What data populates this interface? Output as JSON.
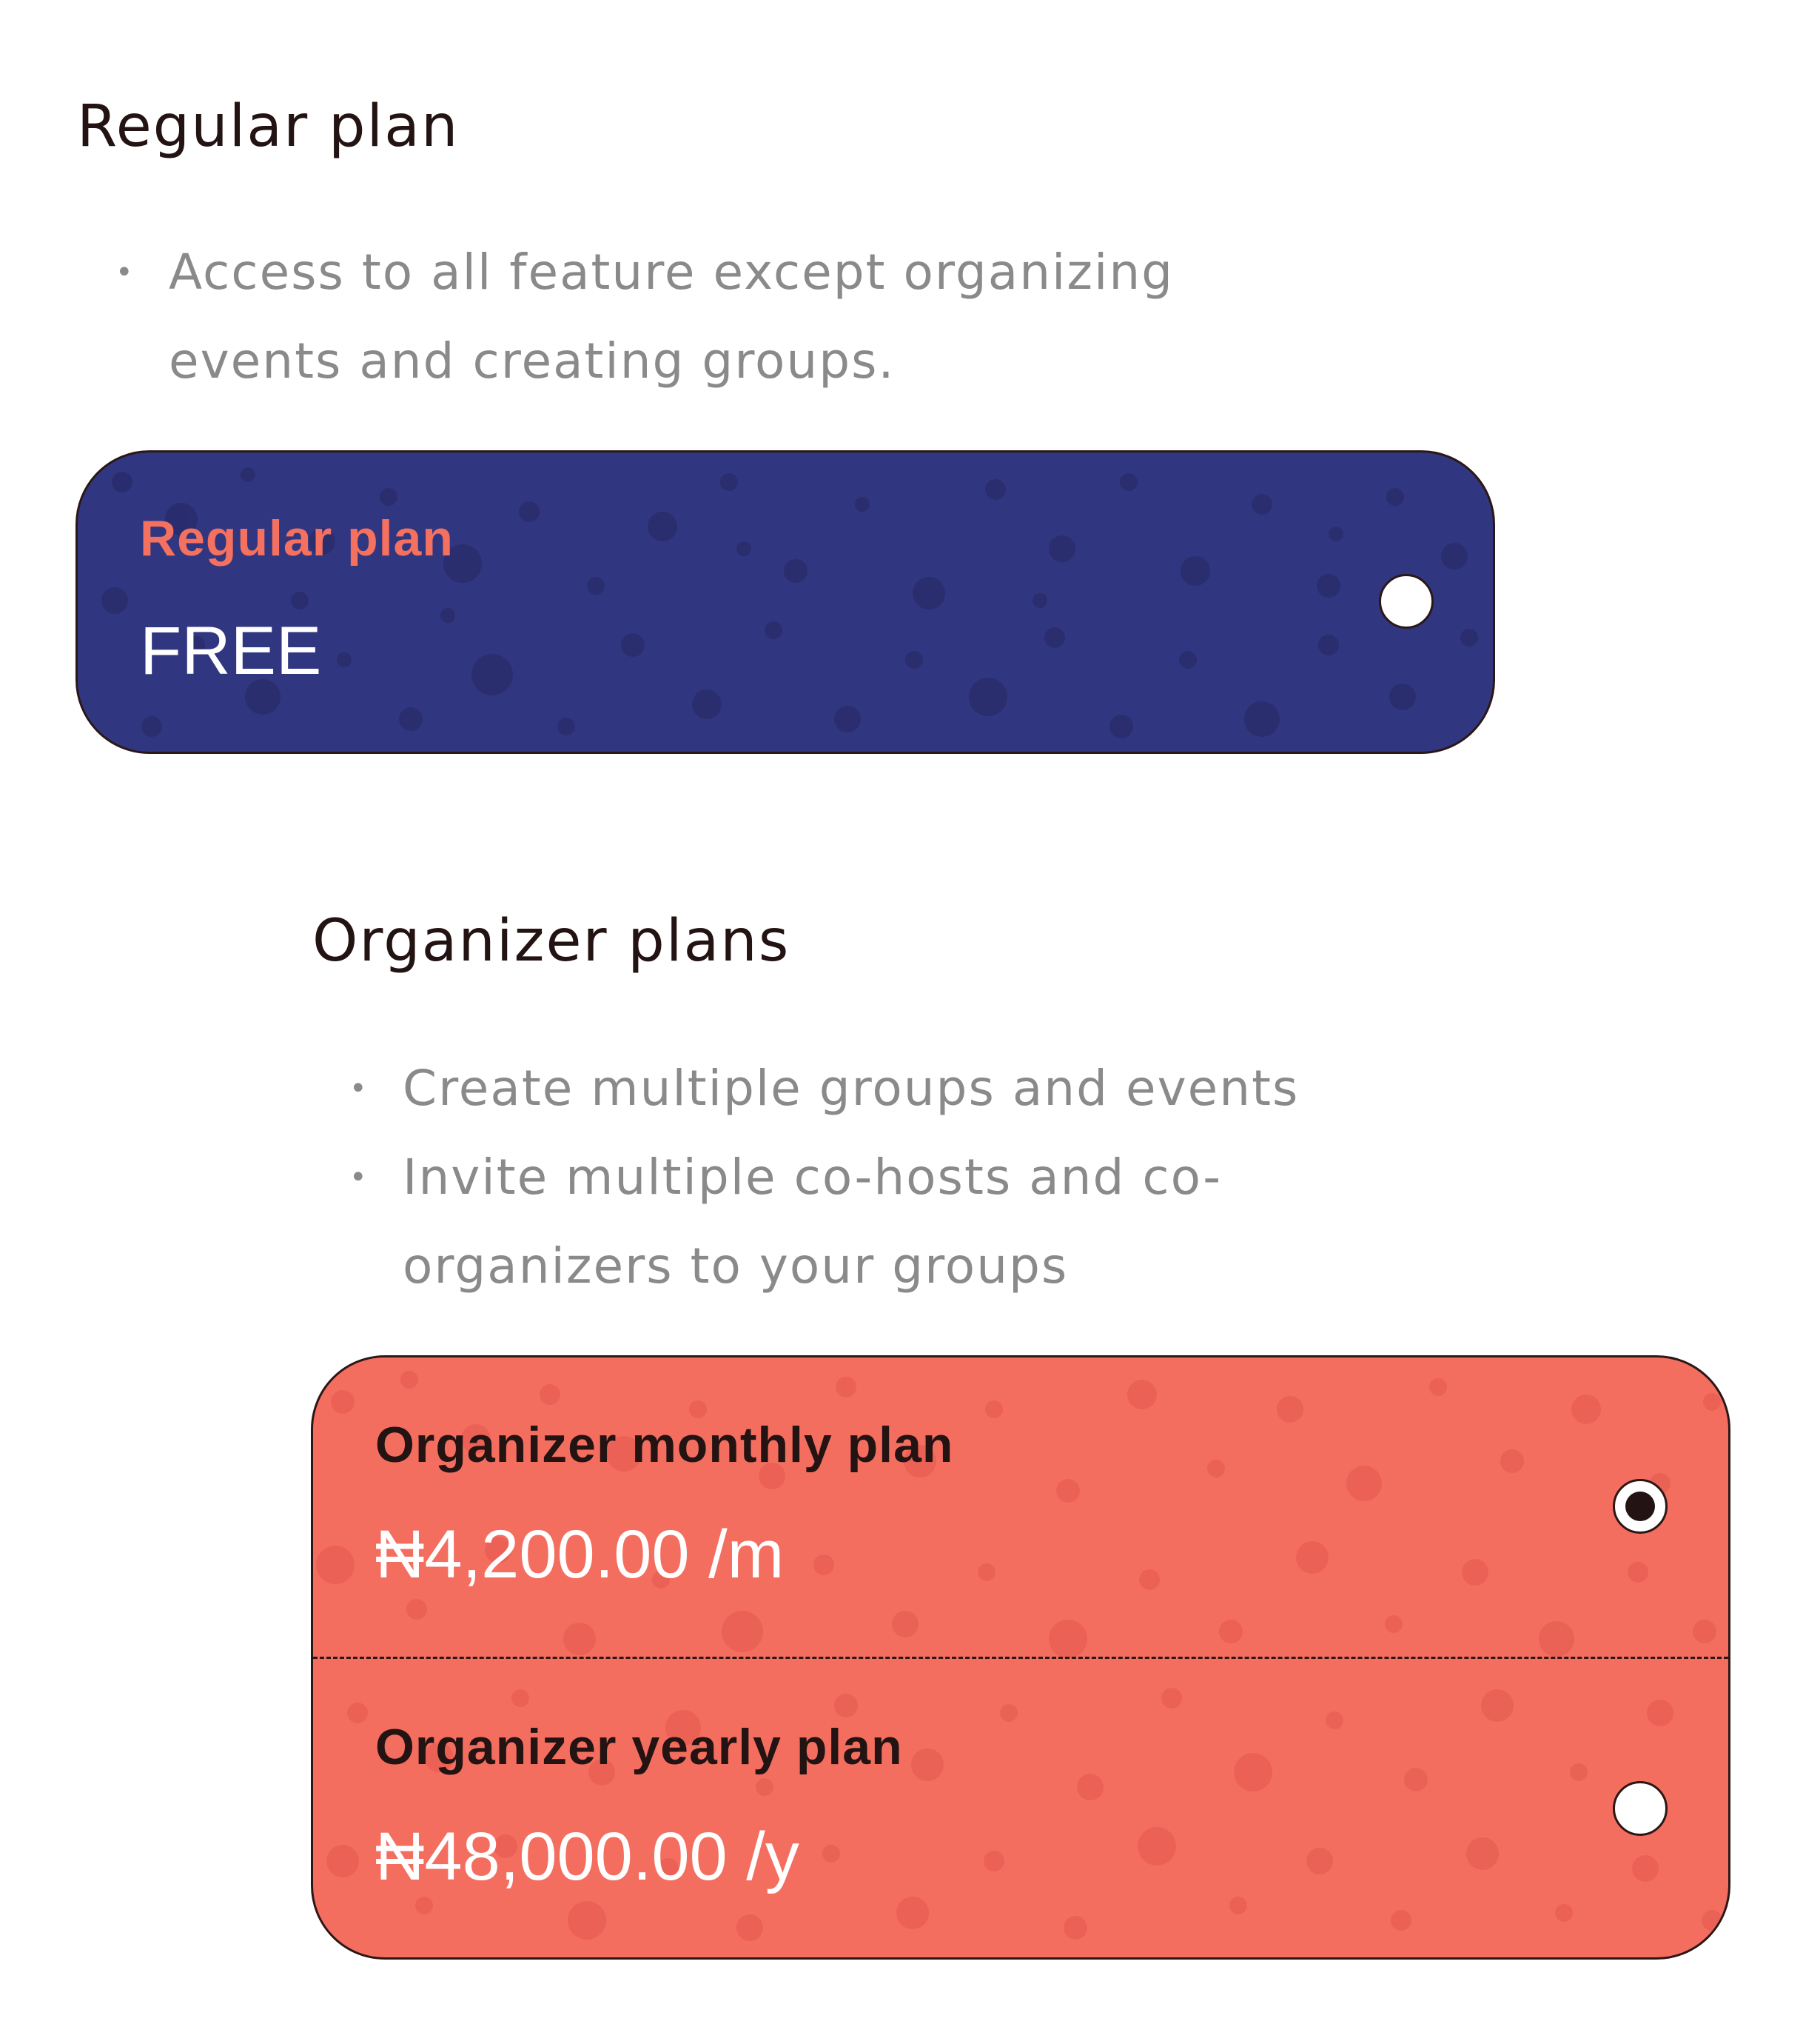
{
  "regular": {
    "heading": "Regular plan",
    "features": [
      "Access to all feature except organizing events and creating groups."
    ],
    "card": {
      "plan_name": "Regular plan",
      "price": "FREE",
      "selected": false,
      "background": "#313680",
      "name_color": "#f4705f"
    }
  },
  "organizer": {
    "heading": "Organizer plans",
    "features": [
      "Create multiple groups and events",
      "Invite multiple co-hosts and co-organizers to your groups"
    ],
    "background": "#f46e60",
    "name_color": "#231312",
    "options": [
      {
        "plan_name": "Organizer monthly plan",
        "price": "₦4,200.00 /m",
        "selected": true
      },
      {
        "plan_name": "Organizer yearly plan",
        "price": "₦48,000.00 /y",
        "selected": false
      }
    ]
  }
}
